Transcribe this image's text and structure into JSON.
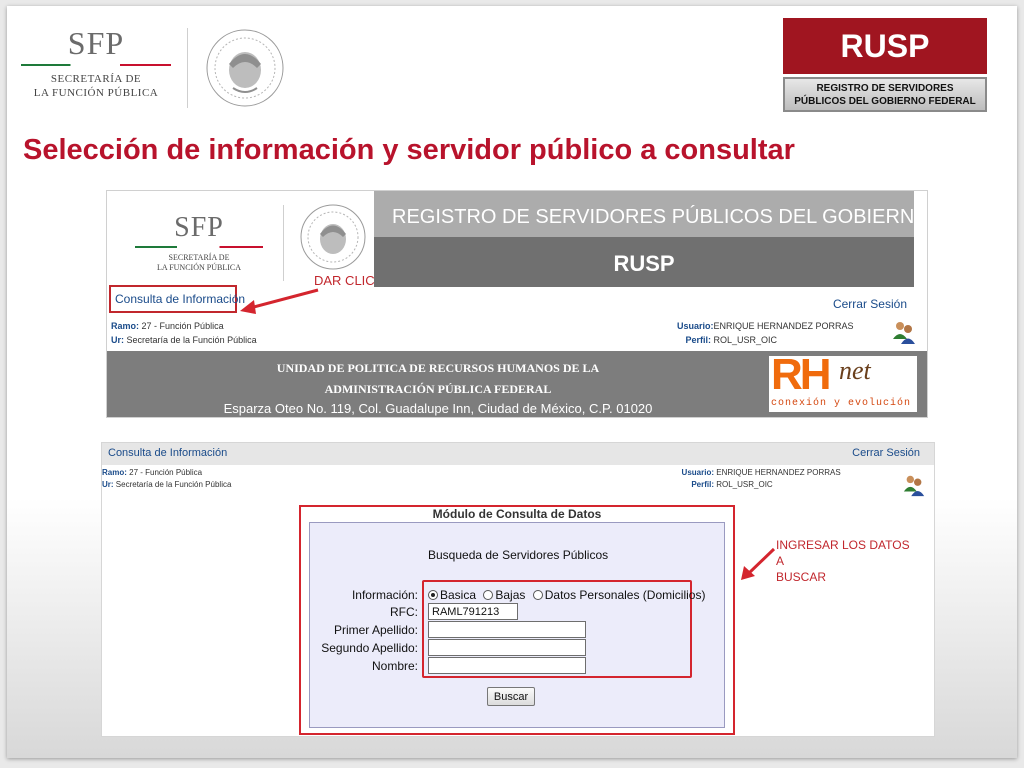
{
  "header": {
    "sfp_logo": "SFP",
    "sfp_sub_line1": "SECRETARÍA DE",
    "sfp_sub_line2": "LA FUNCIÓN PÚBLICA",
    "rusp": "RUSP",
    "rusp_sub_line1": "REGISTRO DE SERVIDORES",
    "rusp_sub_line2": "PÚBLICOS DEL GOBIERNO FEDERAL"
  },
  "slide_title": "Selección de información y servidor público a consultar",
  "screenshot1": {
    "sfp_logo": "SFP",
    "sfp_sub_line1": "SECRETARÍA DE",
    "sfp_sub_line2": "LA FUNCIÓN PÚBLICA",
    "registry_title": "REGISTRO DE SERVIDORES PÚBLICOS DEL GOBIERNO FEDERAL",
    "rusp_band": "RUSP",
    "annotation": "DAR CLIC",
    "consulta_link": "Consulta de Información",
    "cerrar_link": "Cerrar Sesión",
    "ramo_label": "Ramo:",
    "ramo_value": "27 - Función Pública",
    "ur_label": "Ur:",
    "ur_value": "Secretaría de la Función Pública",
    "usuario_label": "Usuario:",
    "usuario_value": "ENRIQUE HERNANDEZ PORRAS",
    "perfil_label": "Perfil:",
    "perfil_value": "ROL_USR_OIC",
    "unit_line1": "UNIDAD DE POLITICA DE RECURSOS HUMANOS DE LA",
    "unit_line2": "ADMINISTRACIÓN PÚBLICA FEDERAL",
    "unit_address": "Esparza Oteo No. 119, Col. Guadalupe Inn, Ciudad de México, C.P. 01020",
    "rhnet_rh": "RH",
    "rhnet_net": "net",
    "rhnet_tagline": "conexión y evolución"
  },
  "screenshot2": {
    "consulta_link": "Consulta de Información",
    "cerrar_link": "Cerrar Sesión",
    "ramo_label": "Ramo:",
    "ramo_value": "27 - Función Pública",
    "ur_label": "Ur:",
    "ur_value": "Secretaría de la Función Pública",
    "usuario_label": "Usuario:",
    "usuario_value": "ENRIQUE HERNANDEZ PORRAS",
    "perfil_label": "Perfil:",
    "perfil_value": "ROL_USR_OIC",
    "module_title": "Módulo de Consulta de Datos",
    "search_title": "Busqueda de Servidores Públicos",
    "fields": {
      "informacion_label": "Información:",
      "radio_basica": "Basica",
      "radio_bajas": "Bajas",
      "radio_datos": "Datos Personales (Domicilios)",
      "rfc_label": "RFC:",
      "rfc_value": "RAML791213",
      "primer_label": "Primer Apellido:",
      "primer_value": "",
      "segundo_label": "Segundo Apellido:",
      "segundo_value": "",
      "nombre_label": "Nombre:",
      "nombre_value": ""
    },
    "buscar_button": "Buscar"
  },
  "annotation2_line1": "INGRESAR LOS DATOS A",
  "annotation2_line2": "BUSCAR",
  "colors": {
    "title_red": "#b8132c",
    "rusp_red": "#a01520",
    "link_blue": "#1a4b8a",
    "annotation_red": "#c1272d"
  }
}
